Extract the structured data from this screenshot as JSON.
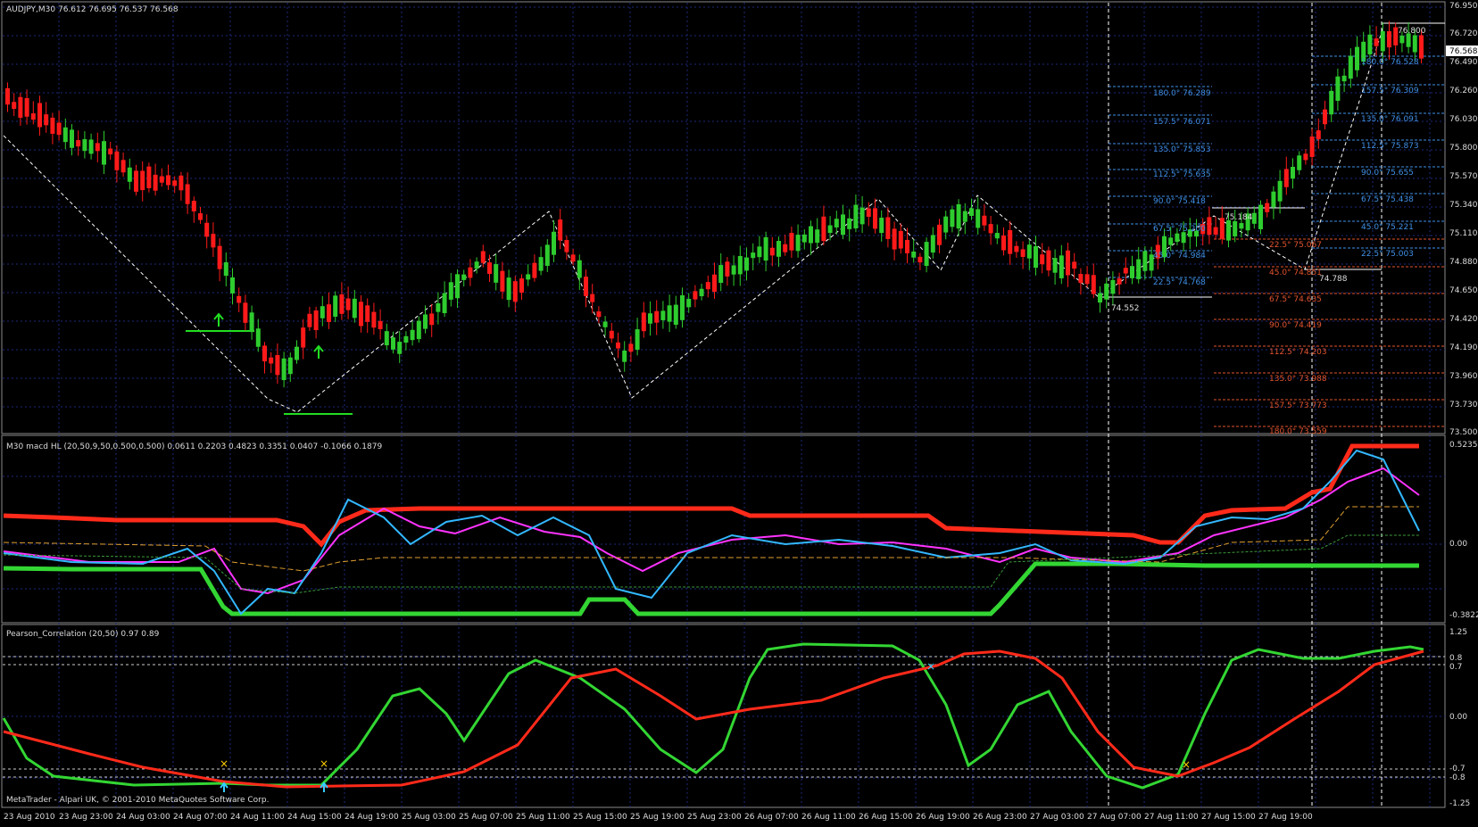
{
  "window": {
    "main_title": "AUDJPY,M30  76.612 76.695 76.537 76.568",
    "macd_title": "M30 macd HL (20,50,9,50,0.500,0.500) 0.0611 0.2203 0.4823 0.3351 0.0407 -0.1066 0.1879",
    "pearson_title": "Pearson_Correlation (20,50) 0.97 0.89",
    "copyright": "MetaTrader - Alpari UK, © 2001-2010 MetaQuotes Software Corp."
  },
  "colors": {
    "background": "#000000",
    "grid": "#1c2a7a",
    "bull_candle": "#2ecc2e",
    "bear_candle": "#ff1a1a",
    "macd_red": "#ff2a1a",
    "macd_green": "#33d633",
    "macd_cyan": "#33b8ff",
    "macd_magenta": "#ff33ff",
    "fib_blue": "#3f8fe6",
    "fib_red": "#e2542e"
  },
  "price_axis": {
    "labels": [
      "76.950",
      "76.720",
      "76.490",
      "76.260",
      "76.030",
      "75.800",
      "75.570",
      "75.340",
      "75.110",
      "74.880",
      "74.650",
      "74.420",
      "74.190",
      "73.960",
      "73.730",
      "73.500"
    ],
    "current_price": "76.568"
  },
  "macd_axis": {
    "labels": [
      "0.5235",
      "0.00",
      "-0.3822"
    ]
  },
  "pearson_axis": {
    "labels": [
      "1.25",
      "0.8",
      "0.7",
      "0.00",
      "-0.7",
      "-0.8",
      "-1.25"
    ]
  },
  "time_axis": {
    "labels": [
      "23 Aug 2010",
      "23 Aug 23:00",
      "24 Aug 03:00",
      "24 Aug 07:00",
      "24 Aug 11:00",
      "24 Aug 15:00",
      "24 Aug 19:00",
      "25 Aug 03:00",
      "25 Aug 07:00",
      "25 Aug 11:00",
      "25 Aug 15:00",
      "25 Aug 19:00",
      "25 Aug 23:00",
      "26 Aug 07:00",
      "26 Aug 11:00",
      "26 Aug 15:00",
      "26 Aug 19:00",
      "26 Aug 23:00",
      "27 Aug 03:00",
      "27 Aug 07:00",
      "27 Aug 11:00",
      "27 Aug 15:00",
      "27 Aug 19:00"
    ]
  },
  "annotations": {
    "low_left": "74.552",
    "mid_high": "75.184",
    "mid_low": "74.788",
    "top_high": "76.800"
  },
  "fib_blue_left": [
    "180.0° 76.289",
    "157.5° 76.071",
    "135.0° 75.853",
    "112.5° 75.635",
    "90.0° 75.418",
    "67.5° 75.200",
    "45.0° 74.984",
    "22.5° 74.768"
  ],
  "fib_blue_right": [
    "180.0° 76.528",
    "157.5° 76.309",
    "135.0° 76.091",
    "112.5° 75.873",
    "90.0° 75.655",
    "67.5° 75.438",
    "45.0° 75.221",
    "22.5° 75.003"
  ],
  "fib_red": [
    "22.5° 75.067",
    "45.0° 74.851",
    "67.5° 74.635",
    "90.0° 74.419",
    "112.5° 74.203",
    "135.0° 73.988",
    "157.5° 73.773",
    "180.0° 73.559"
  ]
}
